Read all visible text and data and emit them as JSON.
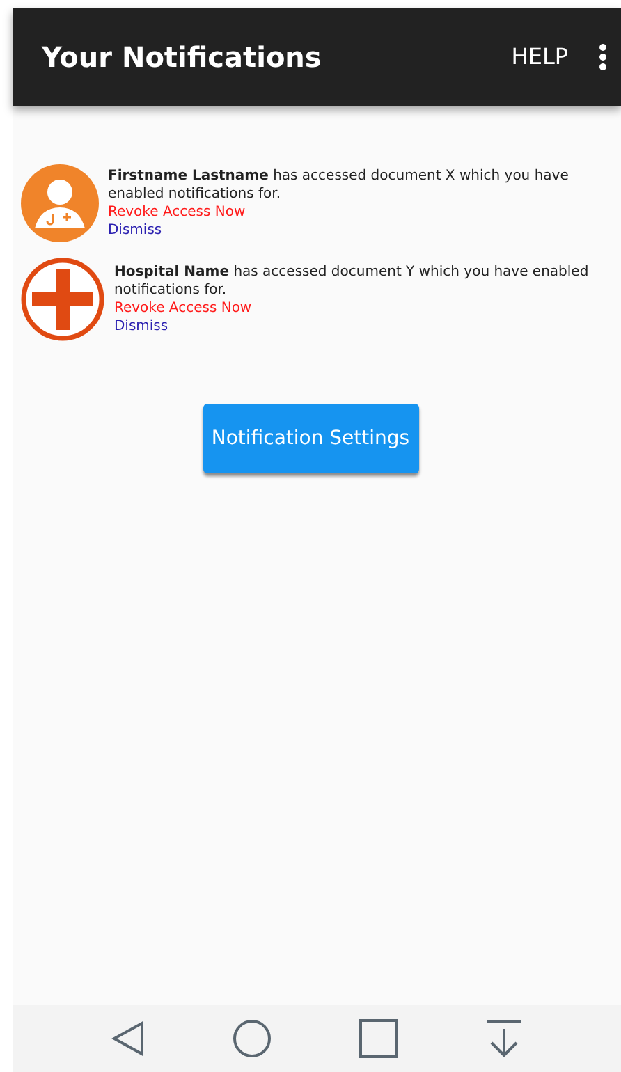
{
  "app_bar": {
    "title": "Your Notifications",
    "action": "HELP"
  },
  "notifications": [
    {
      "kind": "person",
      "text": "**Firstname Lastname** has accessed document X which you have enabled notifications for.",
      "revoke": "Revoke Access Now",
      "dismiss": "Dismiss"
    },
    {
      "kind": "hospital",
      "text": "**Hospital Name** has accessed document Y which you have enabled notifications for.",
      "revoke": "Revoke Access Now",
      "dismiss": "Dismiss"
    }
  ],
  "settings_button": "Notification Settings"
}
